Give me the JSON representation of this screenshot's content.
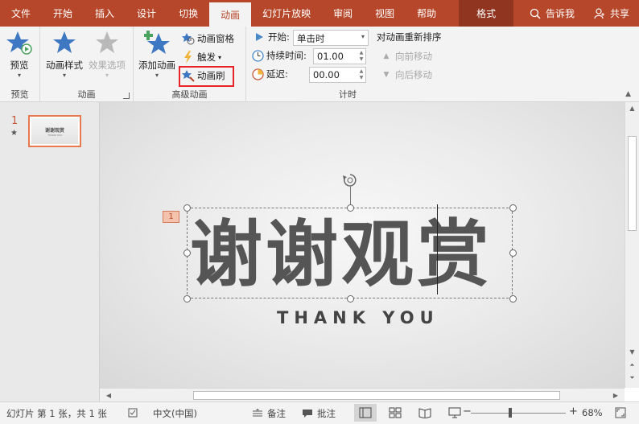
{
  "tabs": [
    {
      "label": "文件"
    },
    {
      "label": "开始"
    },
    {
      "label": "插入"
    },
    {
      "label": "设计"
    },
    {
      "label": "切换"
    },
    {
      "label": "动画"
    },
    {
      "label": "幻灯片放映"
    },
    {
      "label": "审阅"
    },
    {
      "label": "视图"
    },
    {
      "label": "帮助"
    },
    {
      "label": "格式"
    }
  ],
  "tab_active": "动画",
  "tell_me": "告诉我",
  "share": "共享",
  "ribbon": {
    "preview_group": {
      "button": "预览",
      "label": "预览"
    },
    "animation_group": {
      "style_button": "动画样式",
      "effect_button": "效果选项",
      "label": "动画"
    },
    "advanced_group": {
      "add_button": "添加动画",
      "pane_button": "动画窗格",
      "trigger_button": "触发",
      "painter_button": "动画刷",
      "label": "高级动画"
    },
    "timing_group": {
      "start_label": "开始:",
      "start_value": "单击时",
      "duration_label": "持续时间:",
      "duration_value": "01.00",
      "delay_label": "延迟:",
      "delay_value": "00.00",
      "reorder_title": "对动画重新排序",
      "move_earlier": "向前移动",
      "move_later": "向后移动",
      "label": "计时"
    }
  },
  "thumbnail": {
    "number": "1",
    "star": "★",
    "title": "谢谢观赏",
    "subtitle": "THANK YOU"
  },
  "slide": {
    "main_text": "谢谢观赏",
    "sub_text": "THANK YOU",
    "anim_tag": "1"
  },
  "statusbar": {
    "slide_info": "幻灯片 第 1 张，共 1 张",
    "language": "中文(中国)",
    "notes": "备注",
    "comments": "批注",
    "zoom": "68%",
    "zoom_minus": "−",
    "zoom_plus": "+"
  },
  "colors": {
    "accent": "#b7472a",
    "highlight": "#e8242b",
    "star_blue": "#3f78c2",
    "star_green": "#4ba35d"
  }
}
